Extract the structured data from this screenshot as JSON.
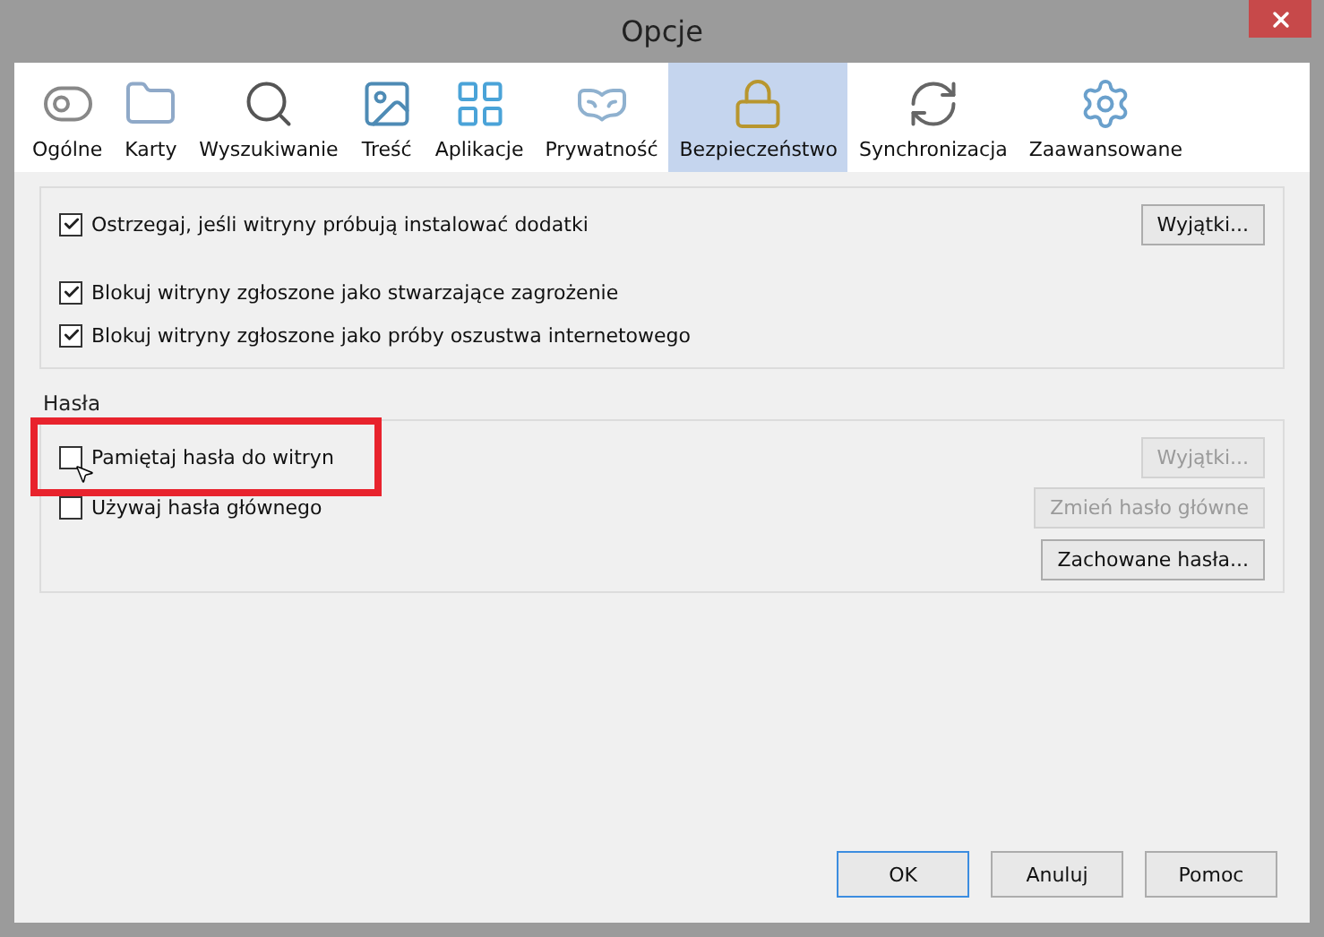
{
  "window": {
    "title": "Opcje"
  },
  "tabs": [
    {
      "label": "Ogólne",
      "selected": false
    },
    {
      "label": "Karty",
      "selected": false
    },
    {
      "label": "Wyszukiwanie",
      "selected": false
    },
    {
      "label": "Treść",
      "selected": false
    },
    {
      "label": "Aplikacje",
      "selected": false
    },
    {
      "label": "Prywatność",
      "selected": false
    },
    {
      "label": "Bezpieczeństwo",
      "selected": true
    },
    {
      "label": "Synchronizacja",
      "selected": false
    },
    {
      "label": "Zaawansowane",
      "selected": false
    }
  ],
  "general": {
    "options": [
      {
        "label": "Ostrzegaj, jeśli witryny próbują instalować dodatki",
        "checked": true,
        "button": {
          "label": "Wyjątki...",
          "disabled": false
        }
      },
      {
        "label": "Blokuj witryny zgłoszone jako stwarzające zagrożenie",
        "checked": true
      },
      {
        "label": "Blokuj witryny zgłoszone jako próby oszustwa internetowego",
        "checked": true
      }
    ]
  },
  "passwords": {
    "title": "Hasła",
    "options": [
      {
        "label": "Pamiętaj hasła do witryn",
        "checked": false,
        "highlighted": true,
        "button": {
          "label": "Wyjątki...",
          "disabled": true
        }
      },
      {
        "label": "Używaj hasła głównego",
        "checked": false,
        "highlighted": false,
        "button": {
          "label": "Zmień hasło główne",
          "disabled": true
        }
      }
    ],
    "extra_button": {
      "label": "Zachowane hasła...",
      "disabled": false
    }
  },
  "buttons": [
    {
      "label": "OK",
      "default": true
    },
    {
      "label": "Anuluj",
      "default": false
    },
    {
      "label": "Pomoc",
      "default": false
    }
  ]
}
